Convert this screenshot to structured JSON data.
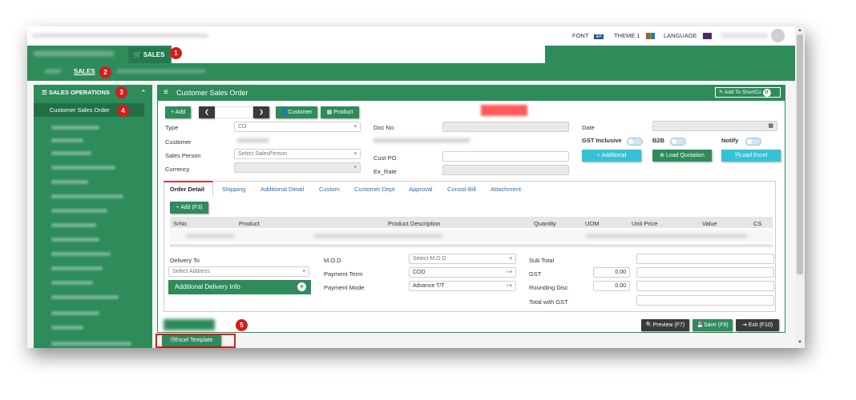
{
  "topbar": {
    "font_label": "FONT",
    "font_icon": "aA",
    "theme_label": "THEME 1",
    "language_label": "LANGUAGE"
  },
  "modules": {
    "sales_tab": "SALES"
  },
  "submenu": {
    "sales": "SALES"
  },
  "sidebar": {
    "section": "SALES OPERATIONS",
    "active_item": "Customer Sales Order"
  },
  "panel": {
    "title": "Customer Sales Order",
    "add_to_shortcut": "Add To ShortCu",
    "shortcut_count": "0"
  },
  "toolbar": {
    "add": "Add",
    "customer": "Customer",
    "product": "Product"
  },
  "form": {
    "type_label": "Type",
    "type_value": "CO",
    "customer_label": "Customer",
    "sales_person_label": "Sales Person",
    "sales_person_placeholder": "Select SalesPerson",
    "currency_label": "Currency",
    "doc_no_label": "Doc No.",
    "cust_po_label": "Cust PO",
    "ex_rate_label": "Ex_Rate",
    "date_label": "Date",
    "gst_inclusive_label": "GST Inclusive",
    "b2b_label": "B2B",
    "notify_label": "Notify",
    "additional_btn": "+ Additional",
    "load_quotation_btn": "Load Quotation",
    "load_excel_btn": "Load Excel"
  },
  "tabs": [
    "Order Detail",
    "Shipping",
    "Additional Detail",
    "Custom",
    "Customer Dept",
    "Approval",
    "Consol-Bill",
    "Attachment"
  ],
  "grid": {
    "add_btn": "Add (F3)",
    "columns": [
      "SrNo",
      "Product",
      "Product Description",
      "Quantity",
      "UOM",
      "Unit Price",
      "Value",
      "CS"
    ]
  },
  "footer_form": {
    "delivery_to_label": "Delivery To",
    "address_placeholder": "Select Address",
    "additional_delivery_btn": "Additional Delivery Info",
    "mod_label": "M.O.D",
    "mod_placeholder": "Select M.O.D",
    "payment_term_label": "Payment Term",
    "payment_term_value": "COD",
    "payment_mode_label": "Payment Mode",
    "payment_mode_value": "Advance T/T",
    "sub_total_label": "Sub Total",
    "gst_label": "GST",
    "gst_value": "0.00",
    "rounding_label": "Rounding Disc",
    "rounding_value": "0.00",
    "total_label": "Total with GST"
  },
  "actions": {
    "preview": "Preview (F7)",
    "save": "Save (F9)",
    "exit": "Exit (F10)",
    "excel_template": "Excel Template"
  },
  "badges": [
    "1",
    "2",
    "3",
    "4",
    "5"
  ],
  "colors": {
    "brand": "#2e8b5a",
    "badge": "#d31d1d",
    "accent": "#33c2d6"
  }
}
